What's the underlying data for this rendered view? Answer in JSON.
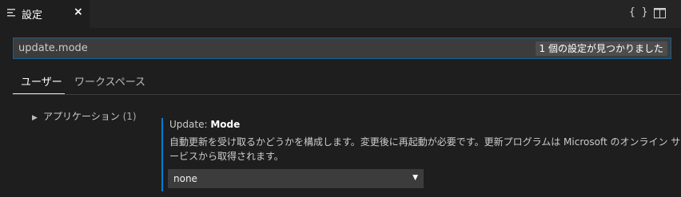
{
  "tab": {
    "title": "設定",
    "close": "×",
    "icon": "settings-list-icon"
  },
  "actions": {
    "json_label": "{ }",
    "json_icon": "open-json-icon",
    "split_icon": "split-editor-icon"
  },
  "search": {
    "value": "update.mode",
    "result_count": "1 個の設定が見つかりました"
  },
  "scopes": {
    "user": "ユーザー",
    "workspace": "ワークスペース"
  },
  "toc": {
    "label": "アプリケーション",
    "count": "(1)"
  },
  "setting": {
    "category": "Update: ",
    "name": "Mode",
    "description": "自動更新を受け取るかどうかを構成します。変更後に再起動が必要です。更新プログラムは Microsoft のオンライン サービスから取得されます。",
    "value": "none"
  },
  "colors": {
    "accent": "#007fd4",
    "focus_border": "#0e639c",
    "background": "#1e1e1e"
  }
}
